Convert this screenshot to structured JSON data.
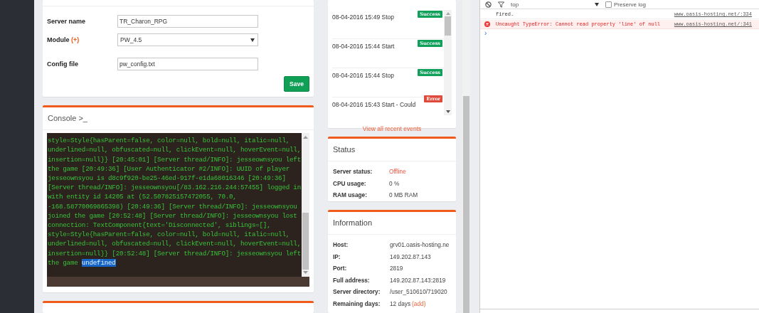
{
  "settings_form": {
    "fields": [
      {
        "label": "Server name",
        "kind": "text",
        "value": "TR_Charon_RPG"
      },
      {
        "label": "Module",
        "label_extra": "(+)",
        "kind": "select",
        "value": "PW_4.5"
      },
      {
        "label": "Config file",
        "kind": "text",
        "value": "pw_config.txt"
      }
    ],
    "save_button": "Save"
  },
  "console": {
    "title": "Console >_",
    "lines": [
      "style=Style{hasParent=false, color=null, bold=null, italic=null,",
      "underlined=null, obfuscated=null, clickEvent=null, hoverEvent=null,",
      "insertion=null}} [20:45:01] [Server thread/INFO]: jesseownsyou left",
      "the game [20:49:36] [User Authenticator #2/INFO]: UUID of player",
      "jesseownsyou is d8c9f920-be25-46ed-917f-e1da68016346 [20:49:36]",
      "[Server thread/INFO]: jesseownsyou[/83.162.216.244:57455] logged in",
      "with entity id 14205 at (52.507825157472055, 70.0,",
      "-168.58770069865398) [20:49:36] [Server thread/INFO]: jesseownsyou",
      "joined the game [20:52:48] [Server thread/INFO]: jesseownsyou lost",
      "connection: TextComponent{text='Disconnected', siblings=[],",
      "style=Style{hasParent=false, color=null, bold=null, italic=null,",
      "underlined=null, obfuscated=null, clickEvent=null, hoverEvent=null,",
      "insertion=null}} [20:52:48] [Server thread/INFO]: jesseownsyou left",
      "the game "
    ],
    "selected_text": "undefined"
  },
  "events": {
    "items": [
      {
        "text": "08-04-2016 15:49 Stop",
        "status": "Success",
        "kind": "success"
      },
      {
        "text": "08-04-2016 15:44 Start",
        "status": "Success",
        "kind": "success"
      },
      {
        "text": "08-04-2016 15:44 Stop",
        "status": "Success",
        "kind": "success"
      },
      {
        "text": "08-04-2016 15:43 Start - Could",
        "status": "Error",
        "kind": "error"
      }
    ],
    "link": "View all recent events"
  },
  "status": {
    "title": "Status",
    "rows": [
      {
        "label": "Server status:",
        "value": "Offline",
        "kind": "alert"
      },
      {
        "label": "CPU usage:",
        "value": "0 %",
        "kind": "plain"
      },
      {
        "label": "RAM usage:",
        "value": "0 MB RAM",
        "kind": "plain"
      }
    ]
  },
  "information": {
    "title": "Information",
    "rows": [
      {
        "label": "Host:",
        "value": "grv01.oasis-hosting.ne"
      },
      {
        "label": "IP:",
        "value": "149.202.87.143"
      },
      {
        "label": "Port:",
        "value": "2819"
      },
      {
        "label": "Full address:",
        "value": "149.202.87.143:2819"
      },
      {
        "label": "Server directory:",
        "value": "/user_510610/719020"
      },
      {
        "label": "Remaining days:",
        "value": "12 days",
        "link": "(add)"
      }
    ]
  },
  "devtools": {
    "context": "top",
    "preserve_log": {
      "label": "Preserve log",
      "checked": false
    },
    "messages": [
      {
        "kind": "info",
        "text": "fired.",
        "source": "www.oasis-hosting.net/:334"
      },
      {
        "kind": "error",
        "text": "Uncaught TypeError: Cannot read property 'line' of null",
        "source": "www.oasis-hosting.net/:341"
      }
    ],
    "prompt": "›"
  }
}
